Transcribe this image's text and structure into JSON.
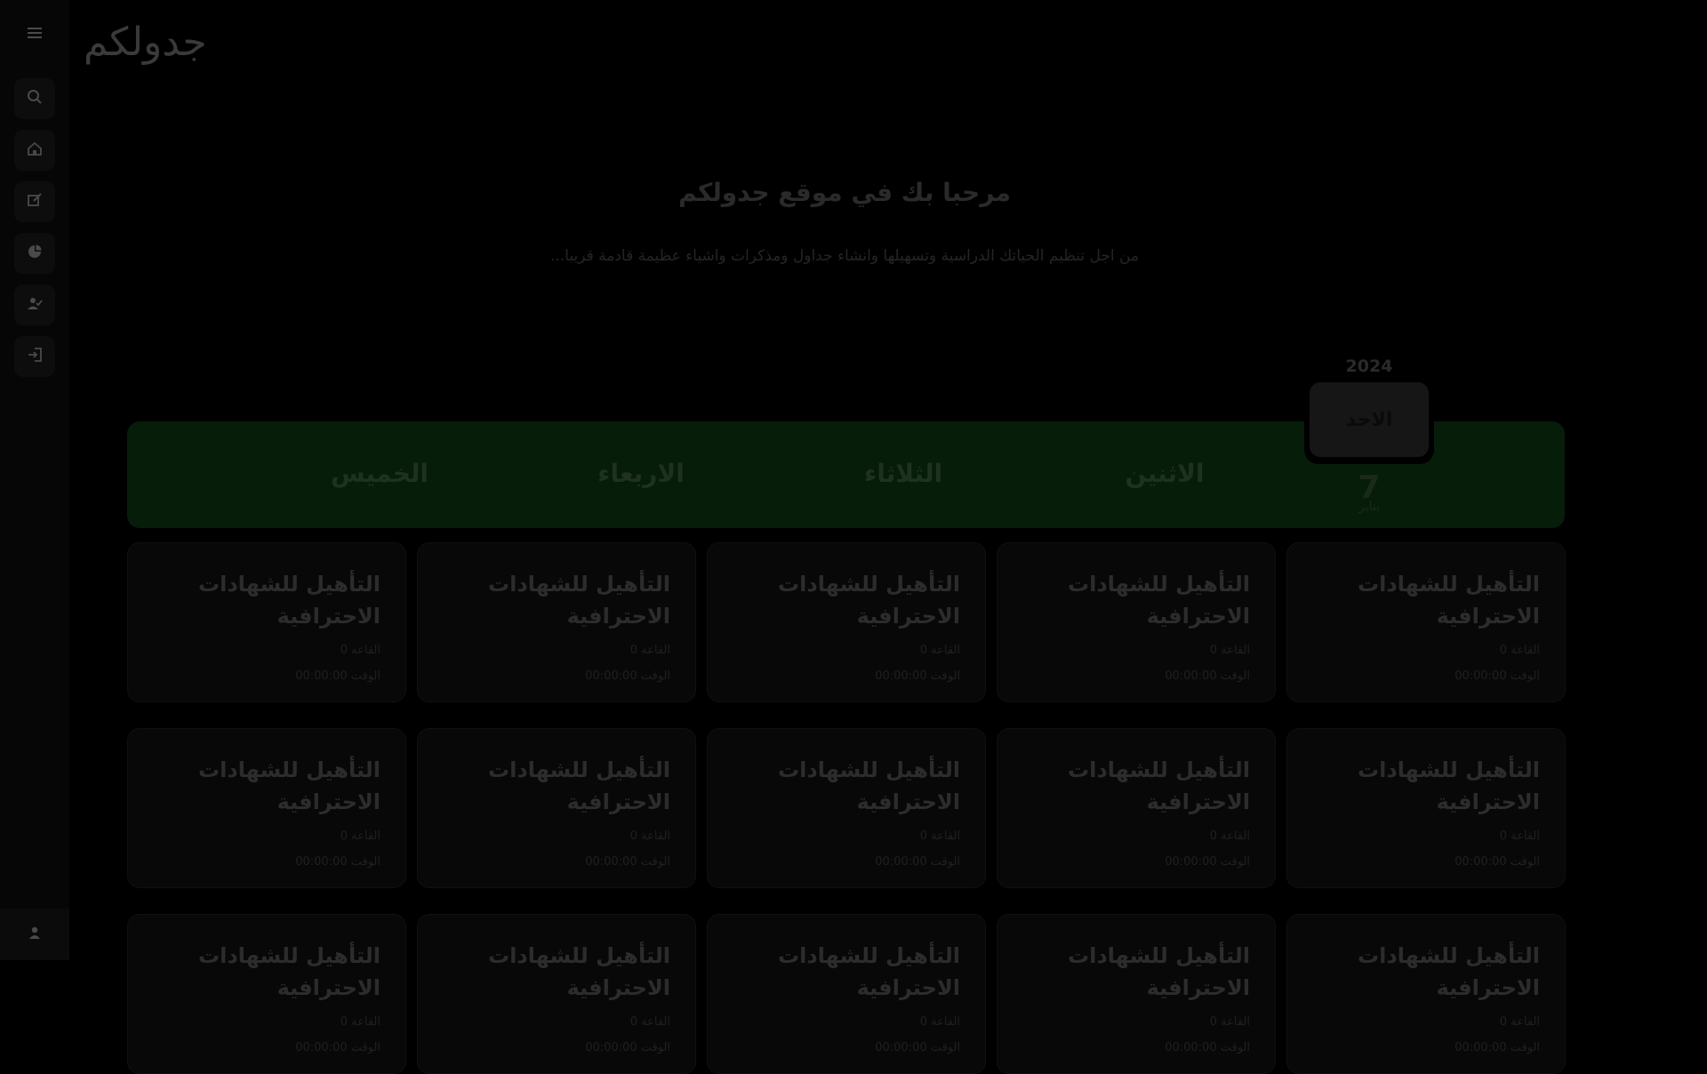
{
  "sidebar": {
    "menu_icon": "hamburger-icon",
    "items": [
      {
        "icon": "search-icon"
      },
      {
        "icon": "home-icon"
      },
      {
        "icon": "edit-icon"
      },
      {
        "icon": "pie-chart-icon"
      },
      {
        "icon": "user-check-icon"
      },
      {
        "icon": "login-icon"
      }
    ],
    "user_icon": "user-icon"
  },
  "header": {
    "brand": "جدولكم"
  },
  "hero": {
    "title": "مرحبا بك في موقع جدولكم",
    "subtitle": "من اجل تنظيم الحياتك الدراسية وتسهيلها وانشاء جداول ومذكرات واشياء عظيمة قادمة قريبا..."
  },
  "calendar": {
    "year": "2024",
    "active_day": "الاحد",
    "date_number": "7",
    "date_month": "يناير",
    "days": [
      "الاثنين",
      "الثلاثاء",
      "الاربعاء",
      "الخميس"
    ],
    "strip_color": "#061d09"
  },
  "schedule": {
    "rows": [
      [
        {
          "title": "التأهيل للشهادات الاحترافية",
          "hall": "القاعة 0",
          "time": "الوقت 00:00:00"
        },
        {
          "title": "التأهيل للشهادات الاحترافية",
          "hall": "القاعة 0",
          "time": "الوقت 00:00:00"
        },
        {
          "title": "التأهيل للشهادات الاحترافية",
          "hall": "القاعة 0",
          "time": "الوقت 00:00:00"
        },
        {
          "title": "التأهيل للشهادات الاحترافية",
          "hall": "القاعة 0",
          "time": "الوقت 00:00:00"
        },
        {
          "title": "التأهيل للشهادات الاحترافية",
          "hall": "القاعة 0",
          "time": "الوقت 00:00:00"
        }
      ],
      [
        {
          "title": "التأهيل للشهادات الاحترافية",
          "hall": "القاعة 0",
          "time": "الوقت 00:00:00"
        },
        {
          "title": "التأهيل للشهادات الاحترافية",
          "hall": "القاعة 0",
          "time": "الوقت 00:00:00"
        },
        {
          "title": "التأهيل للشهادات الاحترافية",
          "hall": "القاعة 0",
          "time": "الوقت 00:00:00"
        },
        {
          "title": "التأهيل للشهادات الاحترافية",
          "hall": "القاعة 0",
          "time": "الوقت 00:00:00"
        },
        {
          "title": "التأهيل للشهادات الاحترافية",
          "hall": "القاعة 0",
          "time": "الوقت 00:00:00"
        }
      ],
      [
        {
          "title": "التأهيل للشهادات الاحترافية",
          "hall": "القاعة 0",
          "time": "الوقت 00:00:00"
        },
        {
          "title": "التأهيل للشهادات الاحترافية",
          "hall": "القاعة 0",
          "time": "الوقت 00:00:00"
        },
        {
          "title": "التأهيل للشهادات الاحترافية",
          "hall": "القاعة 0",
          "time": "الوقت 00:00:00"
        },
        {
          "title": "التأهيل للشهادات الاحترافية",
          "hall": "القاعة 0",
          "time": "الوقت 00:00:00"
        },
        {
          "title": "التأهيل للشهادات الاحترافية",
          "hall": "القاعة 0",
          "time": "الوقت 00:00:00"
        }
      ]
    ]
  }
}
